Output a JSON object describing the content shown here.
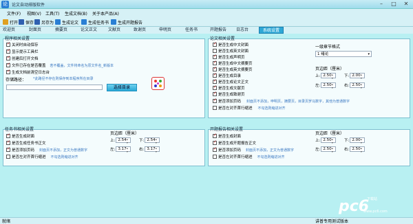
{
  "window": {
    "title": "论文自动排版软件"
  },
  "menu": [
    "文件(F)",
    "视图(V)",
    "工具(T)",
    "生成文档(B)",
    "关于本产品(A)"
  ],
  "toolbar": [
    {
      "label": "打开",
      "icon": "folder-open-icon",
      "color": "#e0a020"
    },
    {
      "label": "保存",
      "icon": "save-icon",
      "color": "#3060b0"
    },
    {
      "label": "另存为",
      "icon": "save-as-icon",
      "color": "#3060b0"
    },
    {
      "label": "生成论文",
      "icon": "doc-icon",
      "color": "#2a7fd4"
    },
    {
      "label": "生成任务书",
      "icon": "doc-icon",
      "color": "#2a7fd4"
    },
    {
      "label": "生成开题报告",
      "icon": "doc-icon",
      "color": "#2a7fd4"
    }
  ],
  "tabs": [
    "欢迎页",
    "封面页",
    "摘要页",
    "论文正文",
    "文献页",
    "致谢页",
    "申明页",
    "任务书",
    "开题报告",
    "日志台",
    "系统设置"
  ],
  "program": {
    "title": "程序相关设置",
    "options": [
      {
        "label": "关闭时自动保存",
        "checked": true
      },
      {
        "label": "显示提示工具栏",
        "checked": true
      },
      {
        "label": "创建后打开文档",
        "checked": true
      },
      {
        "label": "文件已存在是否覆盖",
        "checked": true,
        "note": "若不覆盖，文件将命名为原文件名_新版本"
      },
      {
        "label": "生成文档前清空日志台",
        "checked": true
      }
    ],
    "store_label": "存储路径：",
    "store_note": "*此路径不存在则保存到本程序所在目录",
    "select_dir": "选择目录"
  },
  "paper": {
    "title": "论文相关设置",
    "options": [
      {
        "label": "是否生成中文封面",
        "checked": true
      },
      {
        "label": "是否生成英文封面",
        "checked": false
      },
      {
        "label": "是否生成声明页",
        "checked": true
      },
      {
        "label": "是否生成中文摘要页",
        "checked": true
      },
      {
        "label": "是否生成英文摘要页",
        "checked": true
      },
      {
        "label": "是否生成目录",
        "checked": true
      },
      {
        "label": "是否生成论文正文",
        "checked": true
      },
      {
        "label": "是否生成文献页",
        "checked": true
      },
      {
        "label": "是否生成致谢页",
        "checked": true
      },
      {
        "label": "是否添加页码",
        "checked": true,
        "note": "封面页不添加，申明页，摘要页，目录页罗马数字，其他为普通数字"
      },
      {
        "label": "是否左对齐首行缩进",
        "checked": false,
        "note": "不勾选则缩进对齐"
      }
    ],
    "heading_label": "一级章节格式",
    "heading_value": "1 绪论",
    "margin_label": "页边距（厘米）",
    "margins": {
      "top": "2.50",
      "bottom": "2.00",
      "left": "2.50",
      "right": "2.50"
    }
  },
  "task": {
    "title": "任务书相关设置",
    "options": [
      {
        "label": "是否生成封面",
        "checked": true
      },
      {
        "label": "是否生成任务书正文",
        "checked": true
      },
      {
        "label": "是否添加页码",
        "checked": true,
        "note": "封面页不添加，正文为普通数字"
      },
      {
        "label": "是否左对齐首行缩进",
        "checked": false,
        "note": "不勾选则缩进对齐"
      }
    ],
    "margin_label": "页边距（厘米）",
    "margins": {
      "top": "2.54",
      "bottom": "2.54",
      "left": "3.17",
      "right": "3.17"
    }
  },
  "proposal": {
    "title": "开题报告相关设置",
    "options": [
      {
        "label": "是否生成封面",
        "checked": true
      },
      {
        "label": "是否生成开题报告正文",
        "checked": true
      },
      {
        "label": "是否添加页码",
        "checked": true,
        "note": "封面页不添加，正文为普通数字"
      },
      {
        "label": "是否左对齐首行缩进",
        "checked": false,
        "note": "不勾选则缩进对齐"
      }
    ],
    "margin_label": "页边距（厘米）",
    "margins": {
      "top": "2.50",
      "bottom": "2.00",
      "left": "2.50",
      "right": "2.50"
    }
  },
  "labels": {
    "top": "上:",
    "bottom": "下:",
    "left": "左:",
    "right": "右:"
  },
  "status": {
    "left": "就绪",
    "right": "讲普专用测试版本"
  },
  "watermark": {
    "brand": "pc6",
    "sub1": "下载站",
    "sub2": "www.pc6.com"
  }
}
